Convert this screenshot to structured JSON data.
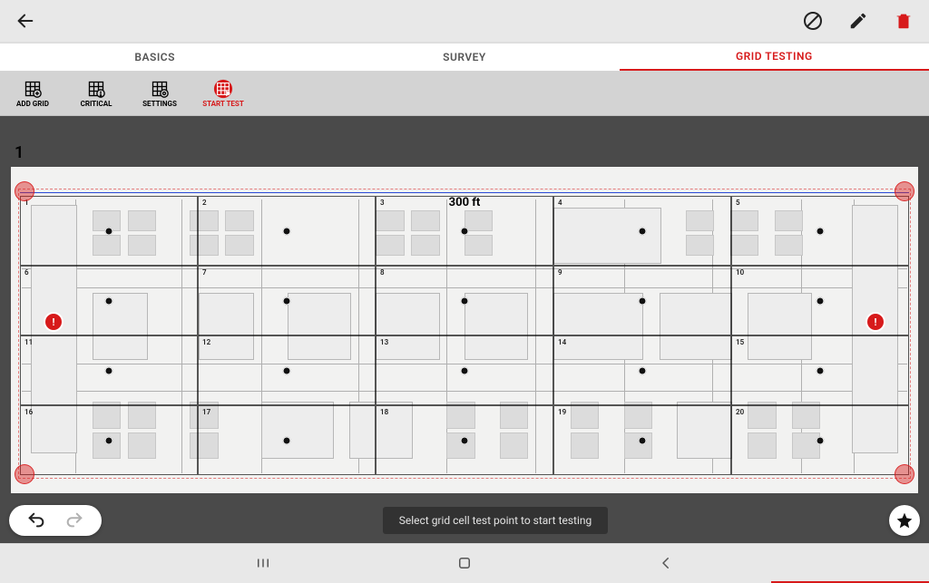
{
  "tabs": {
    "basics": "BASICS",
    "survey": "SURVEY",
    "grid_testing": "GRID TESTING"
  },
  "toolbar": {
    "add_grid": "ADD GRID",
    "critical": "CRITICAL",
    "settings": "SETTINGS",
    "start_test": "START TEST"
  },
  "plan": {
    "page_number": "1",
    "dimension_label": "300 ft"
  },
  "grid_cells": [
    [
      1,
      2,
      3,
      4,
      5
    ],
    [
      6,
      7,
      8,
      9,
      10
    ],
    [
      11,
      12,
      13,
      14,
      15
    ],
    [
      16,
      17,
      18,
      19,
      20
    ]
  ],
  "toast": "Select grid cell test point to start testing",
  "colors": {
    "accent": "#d71a1b"
  }
}
